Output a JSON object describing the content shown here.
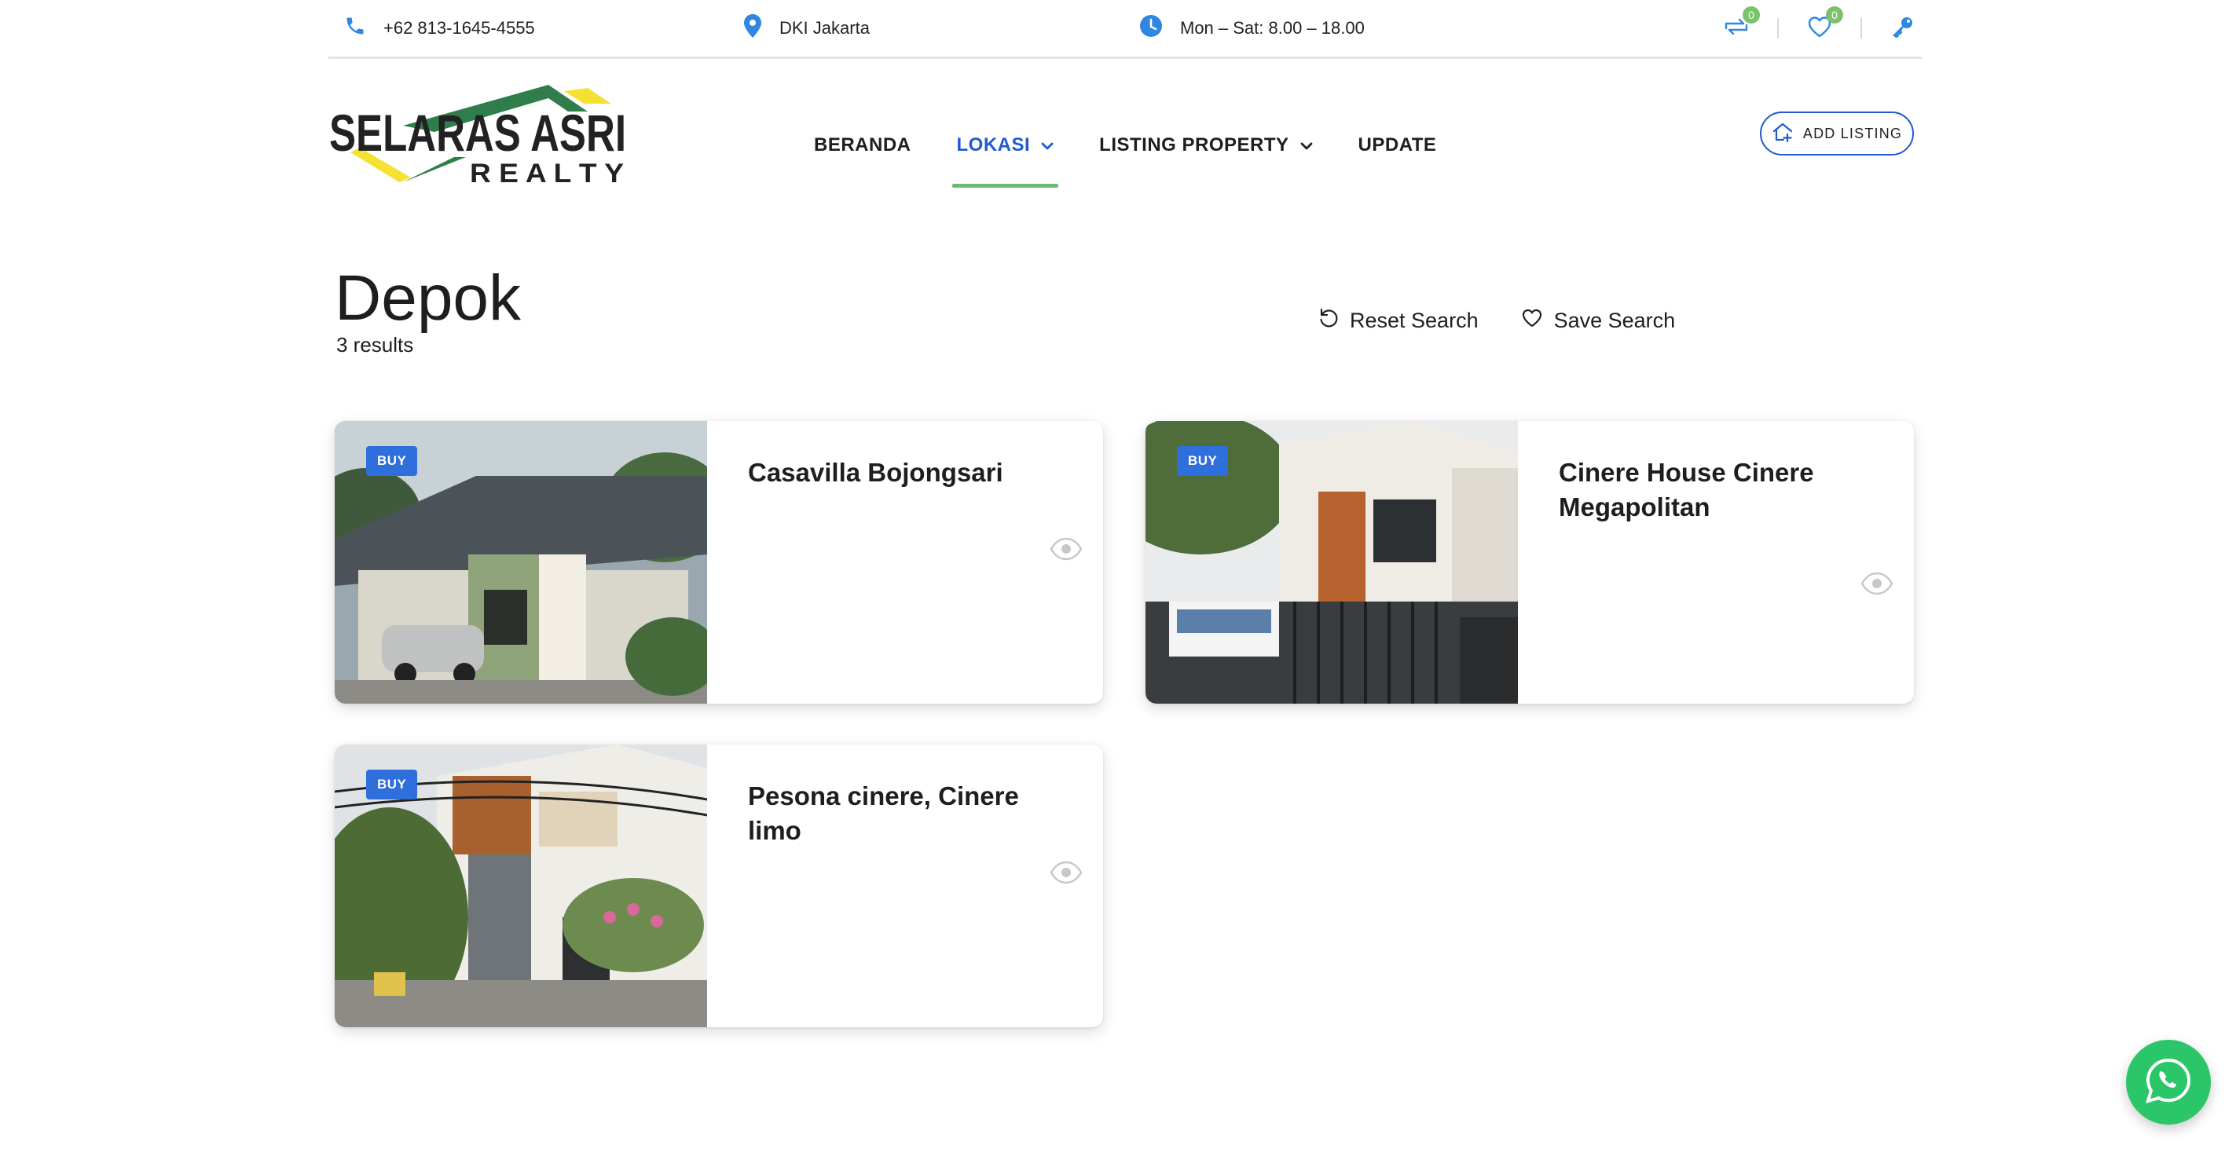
{
  "topbar": {
    "phone": "+62 813-1645-4555",
    "location": "DKI Jakarta",
    "hours": "Mon – Sat: 8.00 – 18.00",
    "compare_count": "0",
    "favorites_count": "0",
    "icons": [
      "phone-icon",
      "map-pin-icon",
      "clock-icon",
      "compare-icon",
      "heart-icon",
      "key-icon"
    ],
    "icon_color": "#2f87e0"
  },
  "logo": {
    "line1": "SELARAS ASRI",
    "line2": "R E A L T Y",
    "colors": {
      "roof_green": "#2f7d4a",
      "roof_yellow": "#f3e233",
      "text": "#222222"
    }
  },
  "nav": {
    "items": [
      {
        "label": "BERANDA",
        "dropdown": false,
        "active": false
      },
      {
        "label": "LOKASI",
        "dropdown": true,
        "active": true
      },
      {
        "label": "LISTING PROPERTY",
        "dropdown": true,
        "active": false
      },
      {
        "label": "UPDATE",
        "dropdown": false,
        "active": false
      }
    ],
    "add_listing": "ADD LISTING",
    "active_color": "#1f5ad1",
    "underline_color": "#6fb874"
  },
  "page": {
    "title": "Depok",
    "results": "3 results",
    "reset_search": "Reset Search",
    "save_search": "Save Search"
  },
  "listings": [
    {
      "badge": "BUY",
      "title": "Casavilla Bojongsari"
    },
    {
      "badge": "BUY",
      "title": "Cinere House Cinere Megapolitan"
    },
    {
      "badge": "BUY",
      "title": "Pesona cinere, Cinere limo"
    }
  ],
  "whatsapp": {
    "icon": "whatsapp-icon",
    "color": "#2cc66a"
  }
}
